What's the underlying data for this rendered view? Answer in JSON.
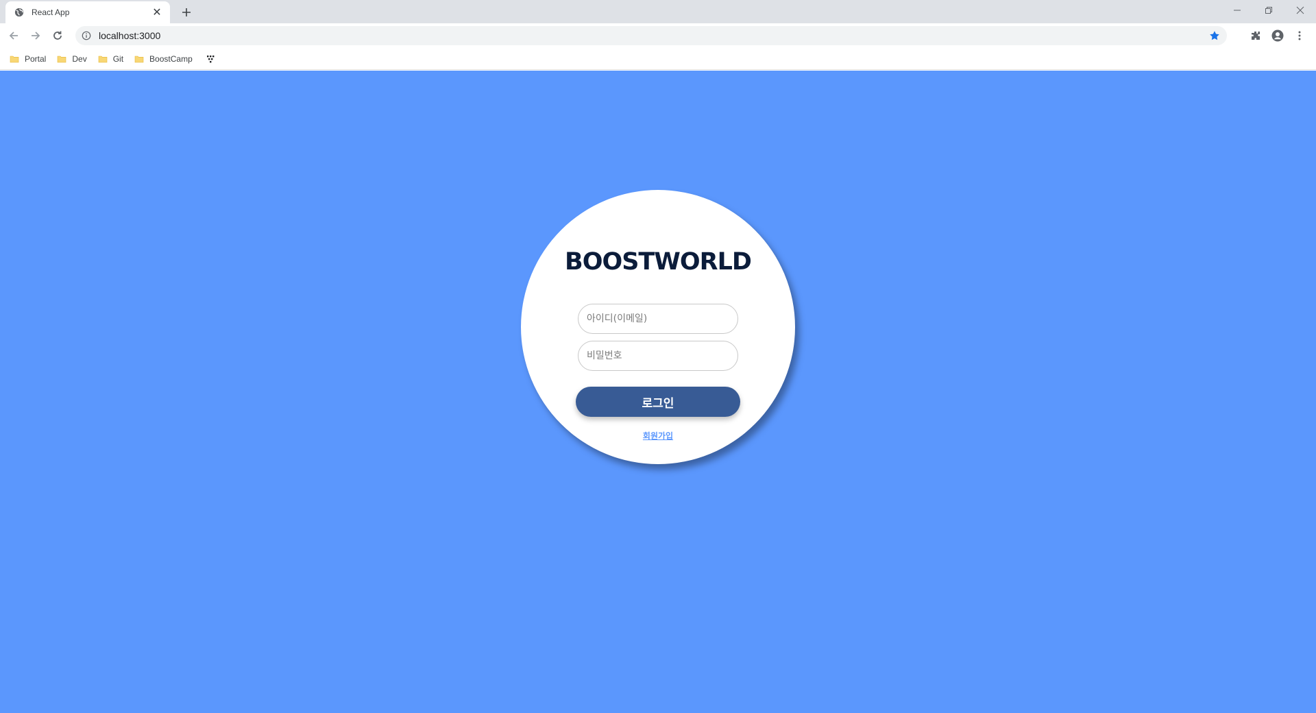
{
  "browser": {
    "tab": {
      "title": "React App",
      "favicon": "globe-icon"
    },
    "address_bar": {
      "url": "localhost:3000"
    },
    "bookmarks": [
      {
        "label": "Portal",
        "icon": "folder-icon"
      },
      {
        "label": "Dev",
        "icon": "folder-icon"
      },
      {
        "label": "Git",
        "icon": "folder-icon"
      },
      {
        "label": "BoostCamp",
        "icon": "folder-icon"
      }
    ],
    "colors": {
      "tabstrip": "#dee1e6",
      "omnibox": "#f1f3f4",
      "star": "#1a73e8",
      "folder": "#f8c74a"
    }
  },
  "page": {
    "background": "#5b97fd",
    "logo": "BOOSTWORLD",
    "id_placeholder": "아이디(이메일)",
    "password_placeholder": "비밀번호",
    "login_label": "로그인",
    "signup_label": "회원가입",
    "colors": {
      "logo": "#0b1c3a",
      "button": "#385b95",
      "link": "#5b97fd"
    }
  }
}
